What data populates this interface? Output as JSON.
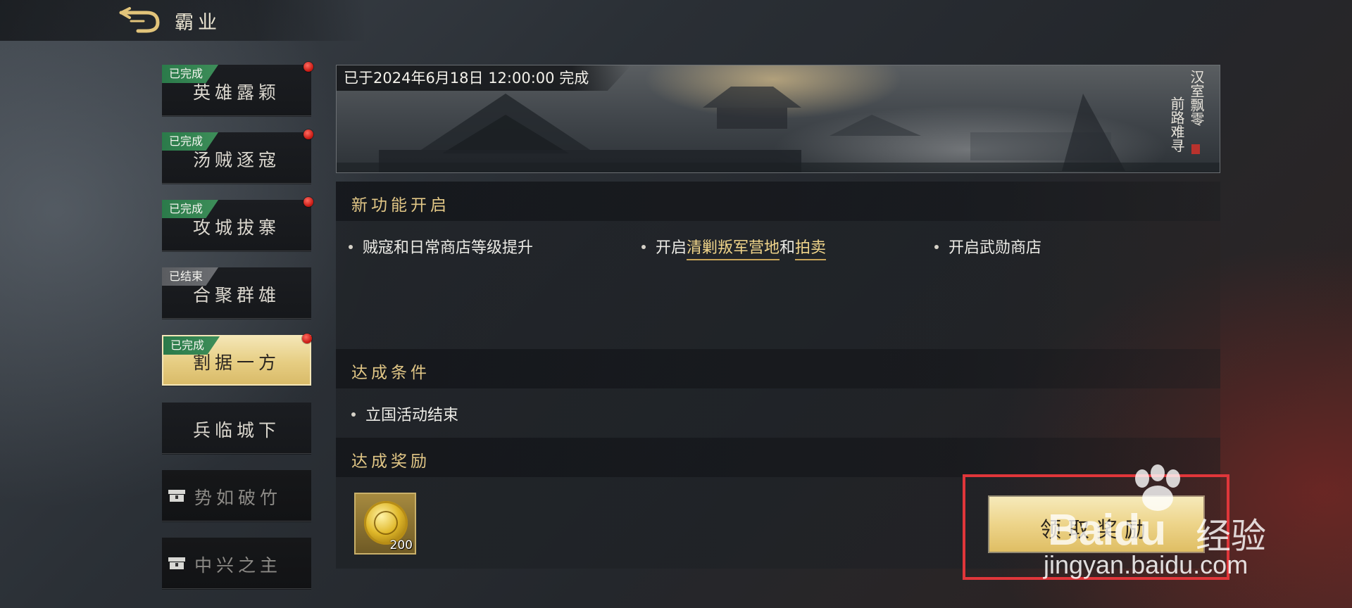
{
  "header": {
    "title": "霸业"
  },
  "sidebar": {
    "items": [
      {
        "label": "英雄露颖",
        "badge": "已完成",
        "badge_type": "done",
        "red_dot": true,
        "state": "normal"
      },
      {
        "label": "汤贼逐寇",
        "badge": "已完成",
        "badge_type": "done",
        "red_dot": true,
        "state": "normal"
      },
      {
        "label": "攻城拔寨",
        "badge": "已完成",
        "badge_type": "done",
        "red_dot": true,
        "state": "normal"
      },
      {
        "label": "合聚群雄",
        "badge": "已结束",
        "badge_type": "ended",
        "red_dot": false,
        "state": "normal"
      },
      {
        "label": "割据一方",
        "badge": "已完成",
        "badge_type": "done",
        "red_dot": true,
        "state": "active"
      },
      {
        "label": "兵临城下",
        "badge": "",
        "red_dot": false,
        "state": "normal"
      },
      {
        "label": "势如破竹",
        "badge": "",
        "red_dot": false,
        "state": "locked",
        "icon": "lock-chest-icon"
      },
      {
        "label": "中兴之主",
        "badge": "",
        "red_dot": false,
        "state": "locked",
        "icon": "lock-chest-icon"
      }
    ]
  },
  "banner": {
    "completed_text": "已于2024年6月18日 12:00:00 完成",
    "poem_col_right": "汉室飘零",
    "poem_col_left": "前路难寻"
  },
  "new_features": {
    "title": "新功能开启",
    "items": [
      {
        "text": "贼寇和日常商店等级提升"
      },
      {
        "prefix": "开启",
        "link1": "清剿叛军营地",
        "middle": "和",
        "link2": "拍卖"
      },
      {
        "text": "开启武勋商店"
      }
    ]
  },
  "conditions": {
    "title": "达成条件",
    "items": [
      "立国活动结束"
    ]
  },
  "rewards": {
    "title": "达成奖励",
    "items": [
      {
        "icon": "gold-coin-icon",
        "count": "200"
      }
    ],
    "claim_label": "领取奖励"
  },
  "colors": {
    "accent_gold": "#e2c786",
    "badge_done": "#2b7a4a",
    "badge_ended": "#5a5c60",
    "highlight_red": "#e0363a"
  },
  "watermark": {
    "brand": "Bai",
    "brand_du": "du",
    "brand_cn": "经验",
    "url": "jingyan.baidu.com"
  }
}
